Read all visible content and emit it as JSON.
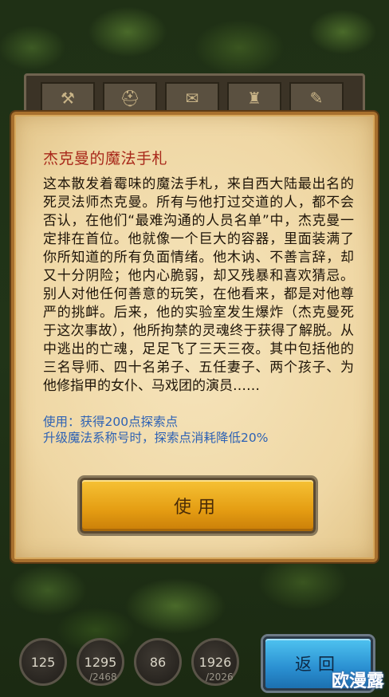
{
  "item_bar": {
    "slots": [
      "axe-icon",
      "helmet-icon",
      "scroll-icon",
      "bell-icon",
      "cloth-icon"
    ]
  },
  "dialog": {
    "title": "杰克曼的魔法手札",
    "description": "这本散发着霉味的魔法手札，来自西大陆最出名的死灵法师杰克曼。所有与他打过交道的人，都不会否认，在他们“最难沟通的人员名单”中，杰克曼一定排在首位。他就像一个巨大的容器，里面装满了你所知道的所有负面情绪。他木讷、不善言辞，却又十分阴险；他内心脆弱，却又残暴和喜欢猜忌。别人对他任何善意的玩笑，在他看来，都是对他尊严的挑衅。后来，他的实验室发生爆炸（杰克曼死于这次事故），他所拘禁的灵魂终于获得了解脱。从中逃出的亡魂，足足飞了三天三夜。其中包括他的三名导师、四十名弟子、五任妻子、两个孩子、为他修指甲的女仆、马戏团的演员……",
    "usage_line1": "使用：获得200点探索点",
    "usage_line2": "升级魔法系称号时，探索点消耗降低20%",
    "use_button": "使用"
  },
  "hud": {
    "stat1": "125",
    "stat2": "1295",
    "stat2_max": "/2468",
    "stat3": "86",
    "stat4": "1926",
    "stat4_max": "/2026",
    "back_button": "返回"
  },
  "watermark": "欧漫露",
  "colors": {
    "title": "#a8281a",
    "usage": "#2e62b4",
    "use_button": "#e49c12",
    "back_button": "#2a8fd1"
  }
}
